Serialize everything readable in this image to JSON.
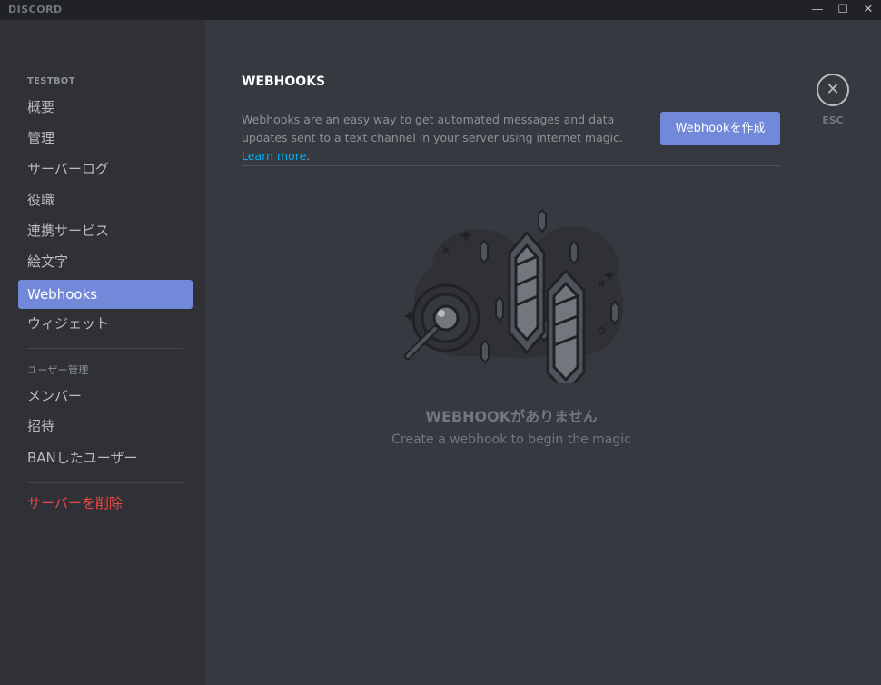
{
  "app": {
    "logo_text": "DISCORD"
  },
  "window_controls": {
    "minimize": "—",
    "maximize": "☐",
    "close": "✕"
  },
  "sidebar": {
    "server_header": "TESTBOT",
    "items": [
      {
        "label": "概要"
      },
      {
        "label": "管理"
      },
      {
        "label": "サーバーログ"
      },
      {
        "label": "役職"
      },
      {
        "label": "連携サービス"
      },
      {
        "label": "絵文字"
      },
      {
        "label": "Webhooks",
        "active": true
      },
      {
        "label": "ウィジェット"
      }
    ],
    "user_header": "ユーザー管理",
    "user_items": [
      {
        "label": "メンバー"
      },
      {
        "label": "招待"
      },
      {
        "label": "BANしたユーザー"
      }
    ],
    "delete_label": "サーバーを削除"
  },
  "main": {
    "title": "WEBHOOKS",
    "description": "Webhooks are an easy way to get automated messages and data updates sent to a text channel in your server using internet magic.",
    "learn_more": "Learn more",
    "create_button": "Webhookを作成",
    "esc_label": "ESC",
    "empty_title": "WEBHOOKがありません",
    "empty_subtitle": "Create a webhook to begin the magic"
  },
  "icons": {
    "close": "close-icon",
    "illustration": "empty-webhooks-illustration"
  },
  "colors": {
    "accent": "#7289da",
    "danger": "#f04747",
    "link": "#00b0f4",
    "background": "#36393f",
    "sidebar": "#2f3136",
    "titlebar": "#202225"
  }
}
